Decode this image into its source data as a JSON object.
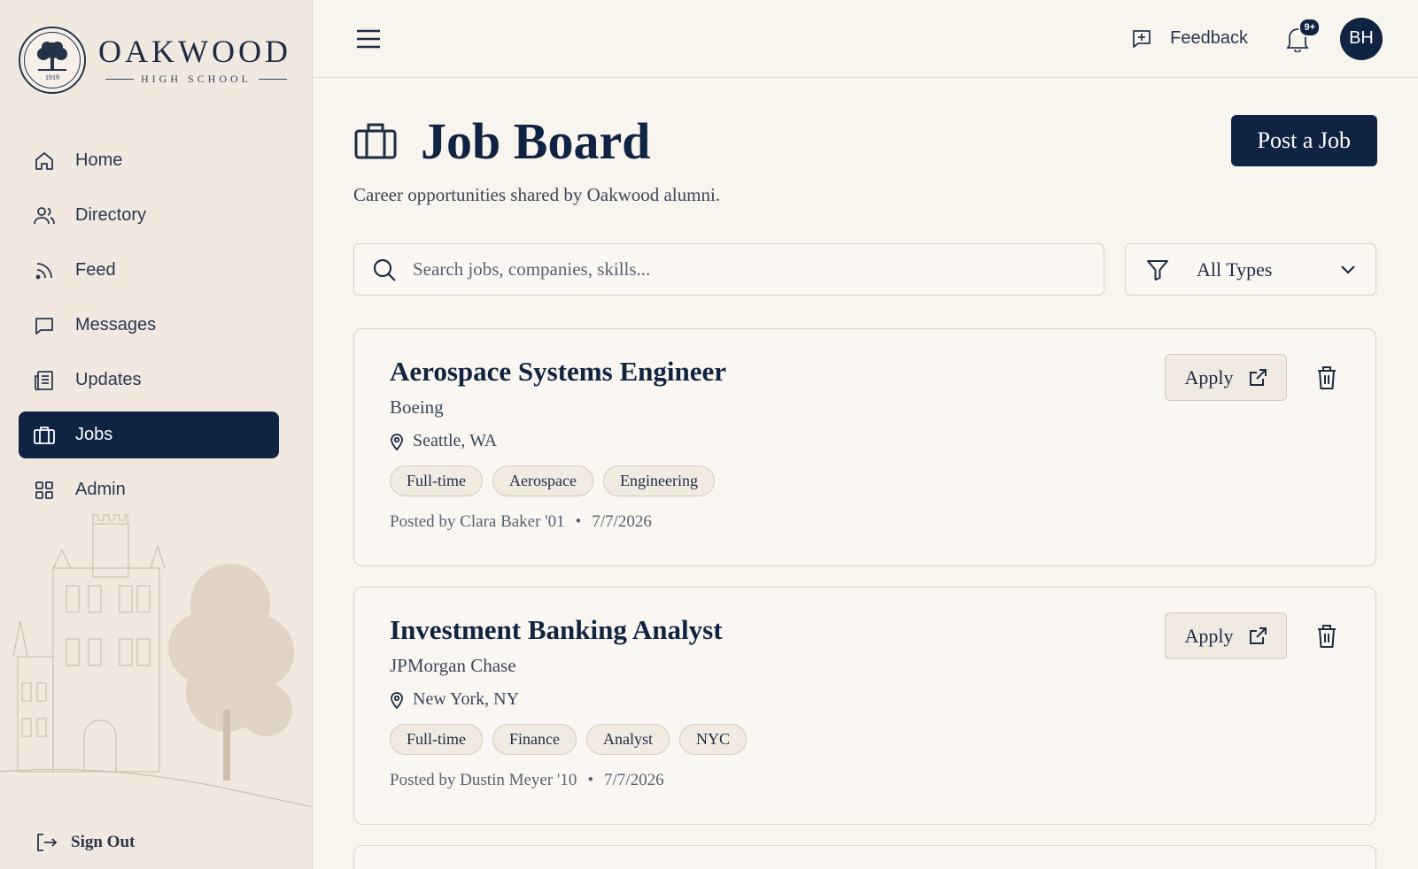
{
  "brand": {
    "name": "OAKWOOD",
    "subtitle": "HIGH SCHOOL",
    "seal_year": "1919"
  },
  "sidebar": {
    "items": [
      {
        "label": "Home",
        "icon": "home-icon",
        "active": false
      },
      {
        "label": "Directory",
        "icon": "users-icon",
        "active": false
      },
      {
        "label": "Feed",
        "icon": "rss-icon",
        "active": false
      },
      {
        "label": "Messages",
        "icon": "message-icon",
        "active": false
      },
      {
        "label": "Updates",
        "icon": "newspaper-icon",
        "active": false
      },
      {
        "label": "Jobs",
        "icon": "briefcase-icon",
        "active": true
      },
      {
        "label": "Admin",
        "icon": "grid-icon",
        "active": false
      }
    ],
    "sign_out": "Sign Out"
  },
  "topbar": {
    "feedback_label": "Feedback",
    "notification_badge": "9+",
    "avatar_initials": "BH"
  },
  "page": {
    "title": "Job Board",
    "subtitle": "Career opportunities shared by Oakwood alumni.",
    "post_button": "Post a Job"
  },
  "search": {
    "placeholder": "Search jobs, companies, skills...",
    "type_filter": "All Types"
  },
  "jobs": [
    {
      "title": "Aerospace Systems Engineer",
      "company": "Boeing",
      "location": "Seattle, WA",
      "tags": [
        "Full-time",
        "Aerospace",
        "Engineering"
      ],
      "posted_by": "Posted by Clara Baker '01",
      "date": "7/7/2026",
      "apply_label": "Apply"
    },
    {
      "title": "Investment Banking Analyst",
      "company": "JPMorgan Chase",
      "location": "New York, NY",
      "tags": [
        "Full-time",
        "Finance",
        "Analyst",
        "NYC"
      ],
      "posted_by": "Posted by Dustin Meyer '10",
      "date": "7/7/2026",
      "apply_label": "Apply"
    }
  ],
  "colors": {
    "navy": "#0f2342",
    "background": "#f8f4ee",
    "sidebar": "#f1e9e0"
  }
}
